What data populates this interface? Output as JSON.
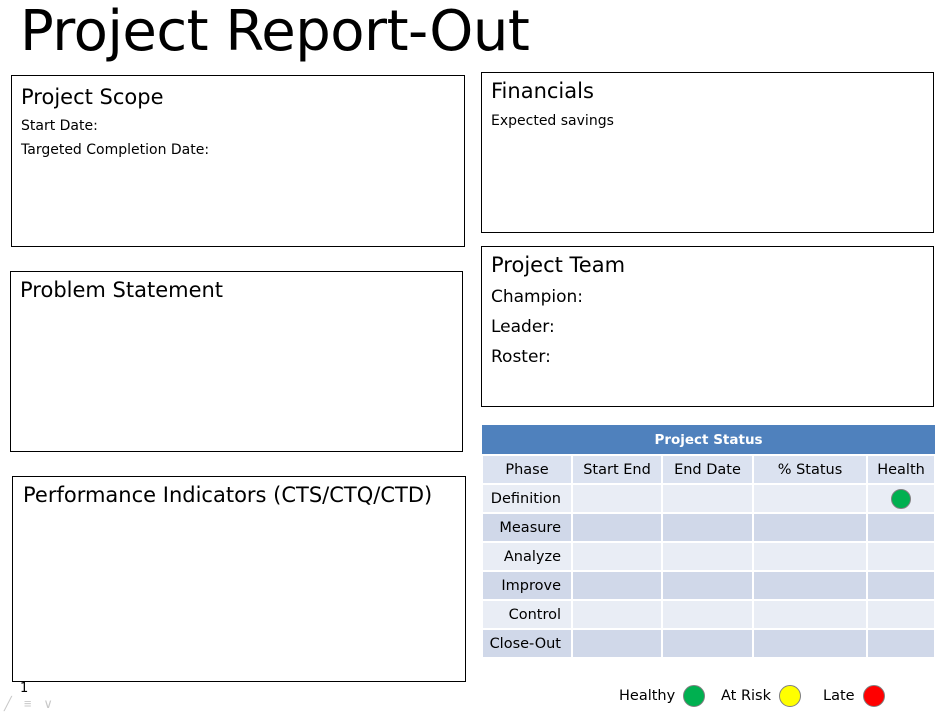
{
  "title": "Project Report-Out",
  "scope": {
    "title": "Project Scope",
    "start_date_label": "Start Date:",
    "completion_label": "Targeted Completion Date:"
  },
  "problem": {
    "title": "Problem Statement"
  },
  "performance": {
    "title": "Performance Indicators (CTS/CTQ/CTD)"
  },
  "financials": {
    "title": "Financials",
    "savings_label": "Expected savings"
  },
  "team": {
    "title": "Project Team",
    "champion_label": "Champion:",
    "leader_label": "Leader:",
    "roster_label": "Roster:"
  },
  "status": {
    "title": "Project Status",
    "columns": [
      "Phase",
      "Start End",
      "End Date",
      "% Status",
      "Health"
    ],
    "phases": [
      "Definition",
      "Measure",
      "Analyze",
      "Improve",
      "Control",
      "Close-Out"
    ],
    "definition_health": "Healthy"
  },
  "legend": {
    "healthy_label": "Healthy",
    "at_risk_label": "At Risk",
    "late_label": "Late"
  },
  "colors": {
    "healthy": "#00b050",
    "at_risk": "#ffff00",
    "late": "#ff0000",
    "table_header": "#4f81bd"
  },
  "page_number": "1",
  "footer_icons": [
    "pen-icon",
    "menu-icon",
    "chevron-down-icon"
  ]
}
